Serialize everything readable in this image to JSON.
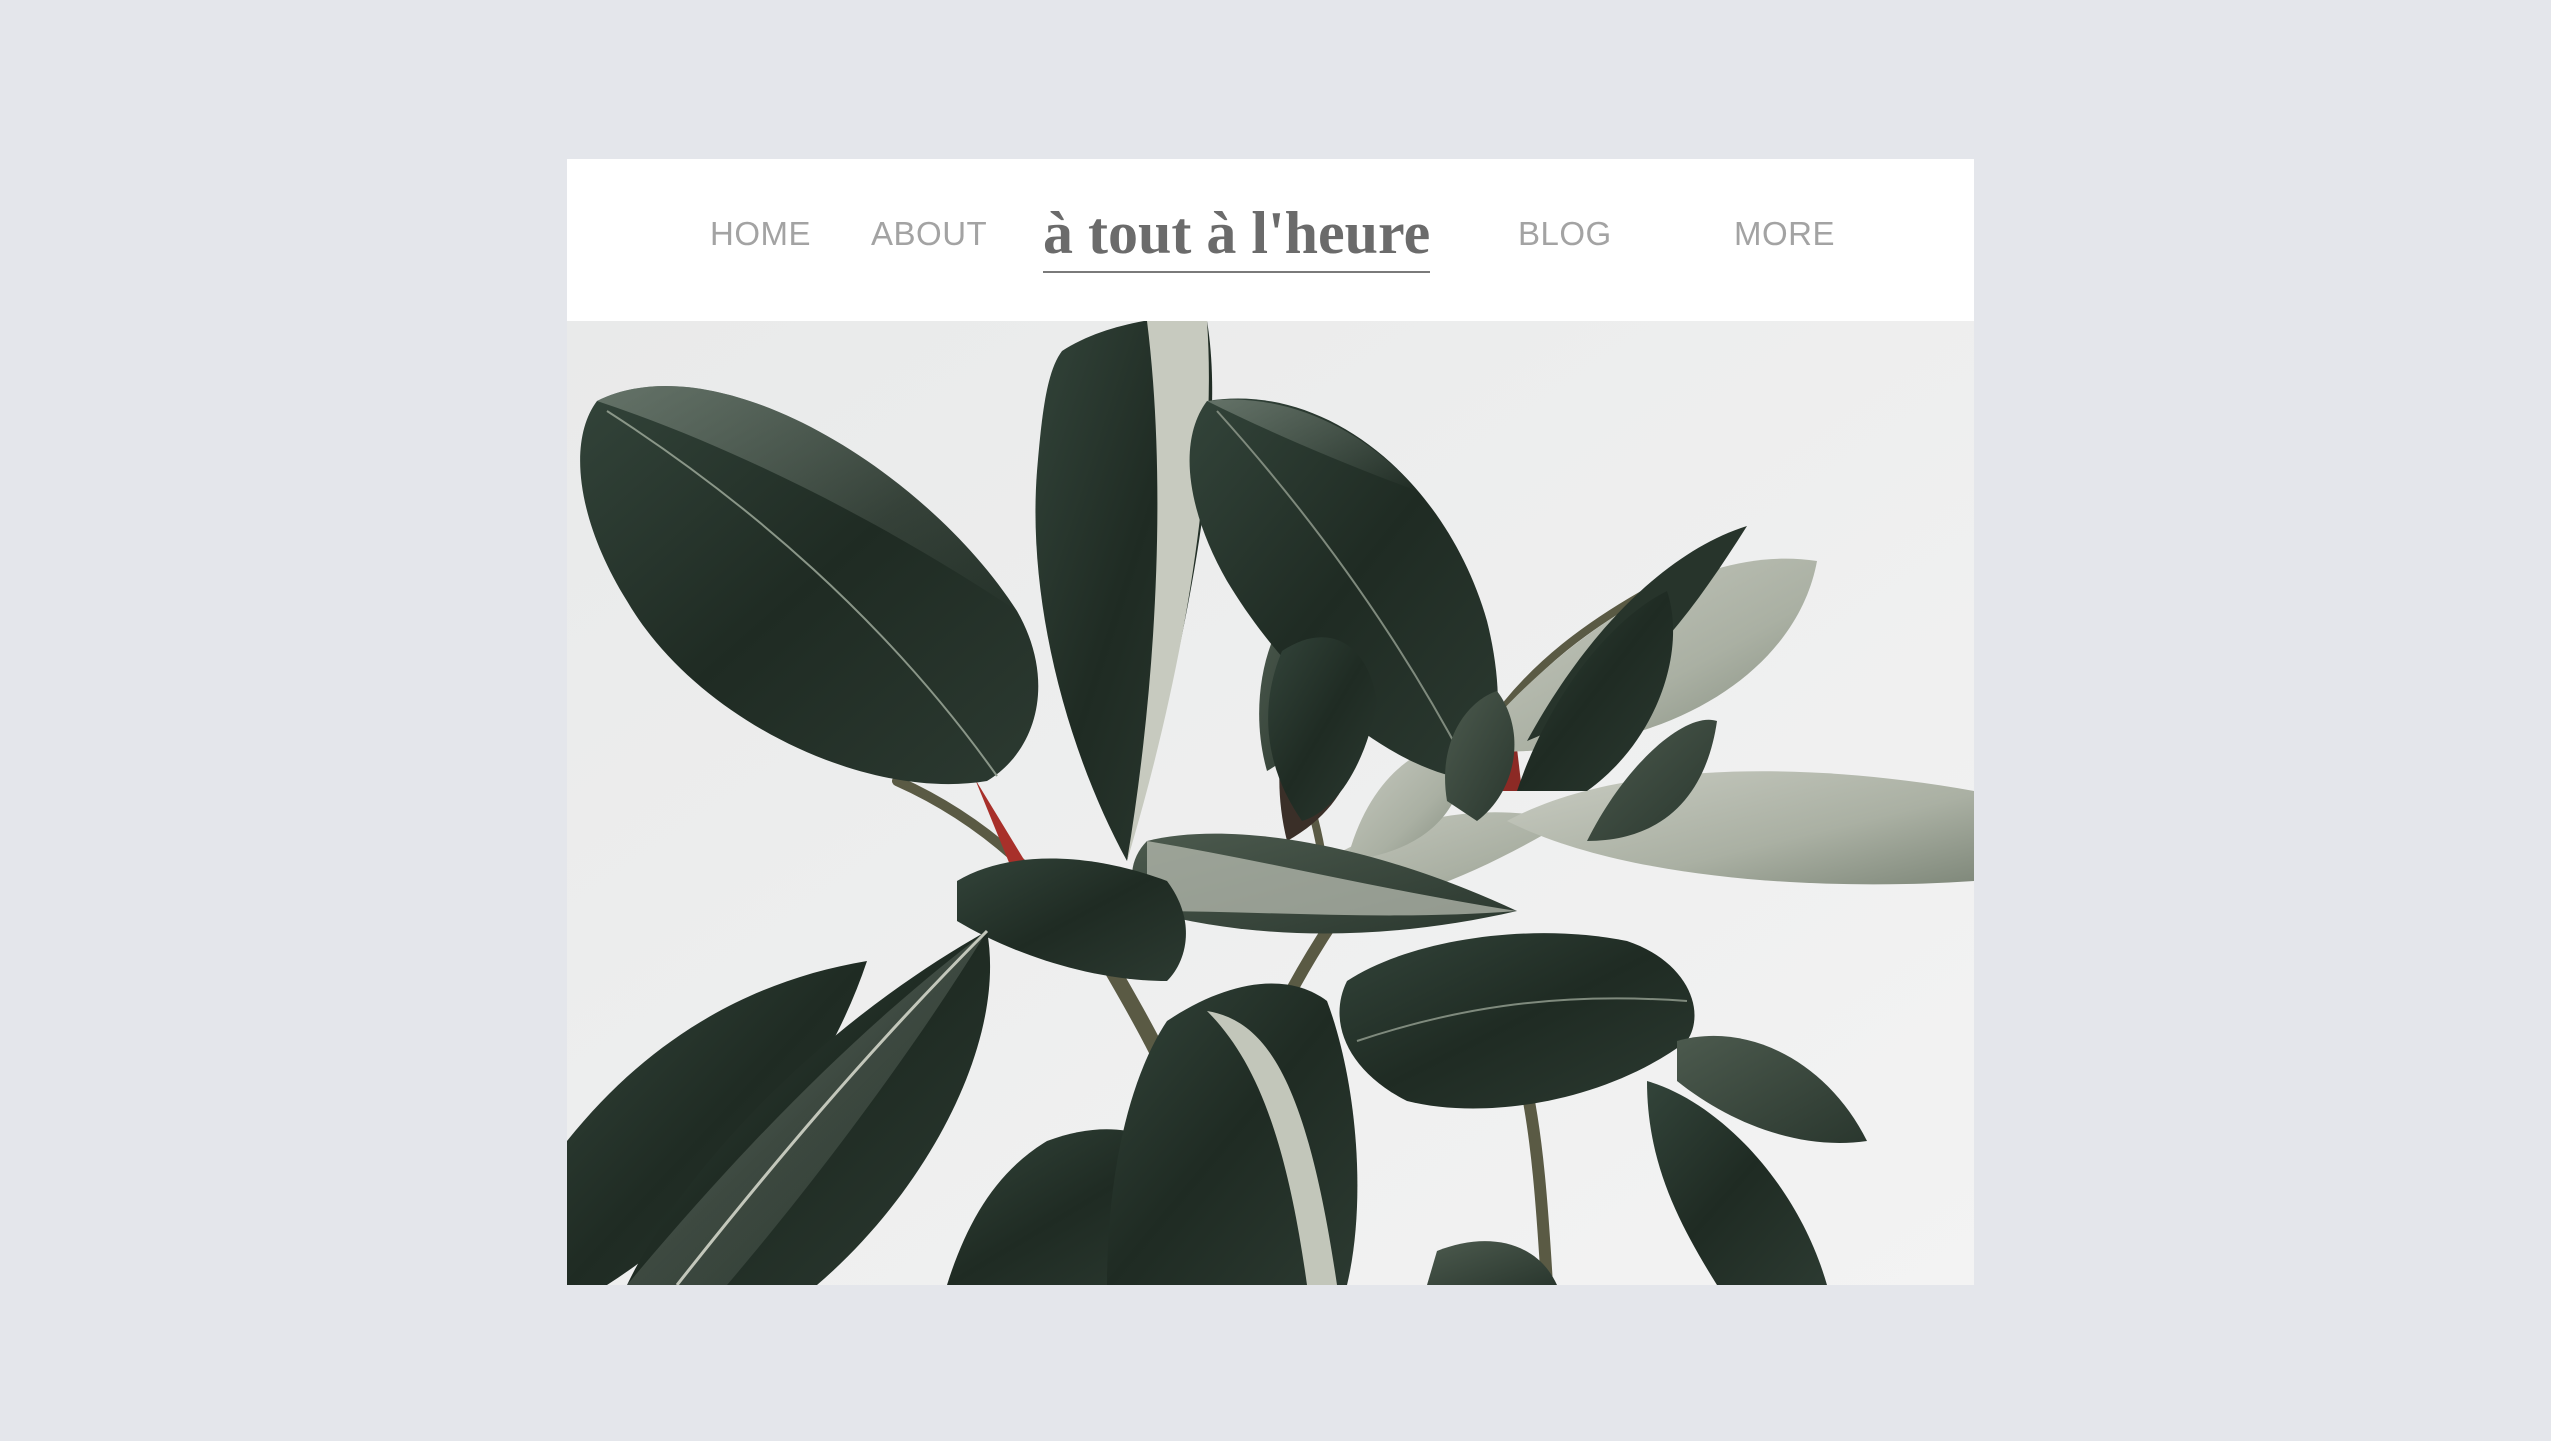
{
  "nav": {
    "home_label": "HOME",
    "about_label": "ABOUT",
    "brand_title": "à tout à l'heure",
    "blog_label": "BLOG",
    "more_label": "MORE"
  },
  "hero": {
    "subject": "rubber plant leaves",
    "alt": "Rubber plant with dark green glossy leaves against a light background"
  },
  "colors": {
    "page_background": "#e4e6eb",
    "nav_text": "#a3a3a3",
    "brand_text": "#6b6b6b",
    "leaf_dark": "#1f2a22",
    "leaf_light": "#b9bdb2",
    "stem_red": "#a8302a"
  }
}
